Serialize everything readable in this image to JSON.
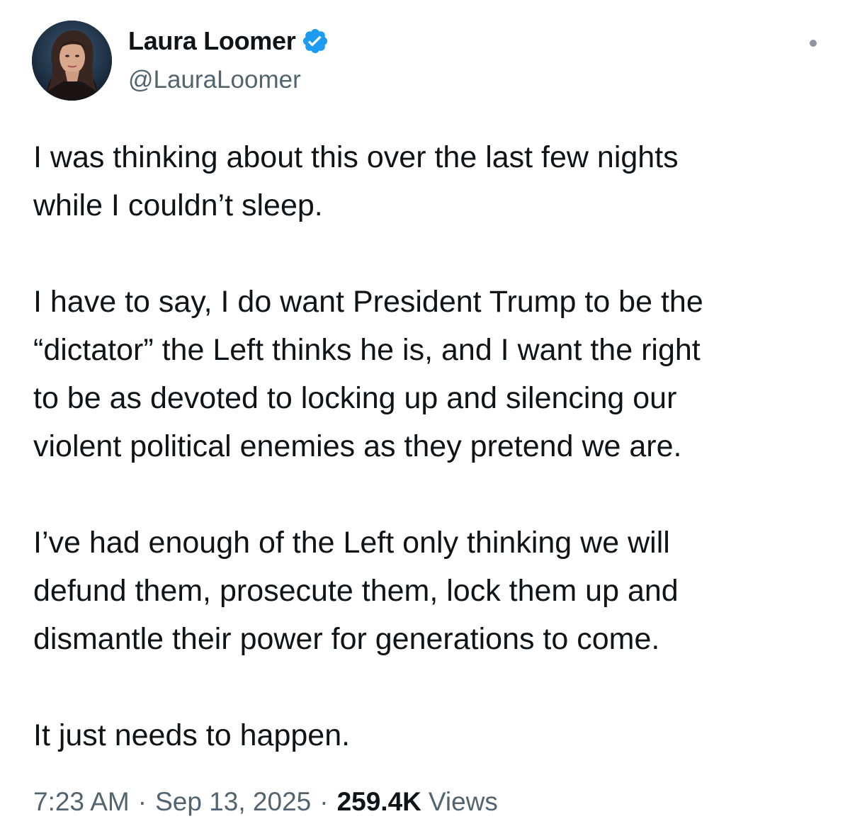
{
  "author": {
    "display_name": "Laura Loomer",
    "handle": "@LauraLoomer",
    "verified": true,
    "verified_color": "#1d9bf0"
  },
  "tweet": {
    "paragraphs": [
      "I was thinking about this over the last few nights\nwhile I couldn’t sleep.",
      "I have to say, I do want President Trump to be the\n“dictator” the Left thinks he is, and I want the right\nto be as devoted to locking up and silencing our\nviolent political enemies as they pretend we are.",
      "I’ve had enough of the Left only thinking we will\ndefund them, prosecute them, lock them up and\ndismantle their power for generations to come.",
      "It just needs to happen."
    ]
  },
  "meta": {
    "time": "7:23 AM",
    "separator": "·",
    "date": "Sep 13, 2025",
    "views_count": "259.4K",
    "views_label": "Views"
  },
  "icons": {
    "avatar": "avatar-photo",
    "verified": "verified-badge-icon",
    "more": "more-options-icon"
  }
}
